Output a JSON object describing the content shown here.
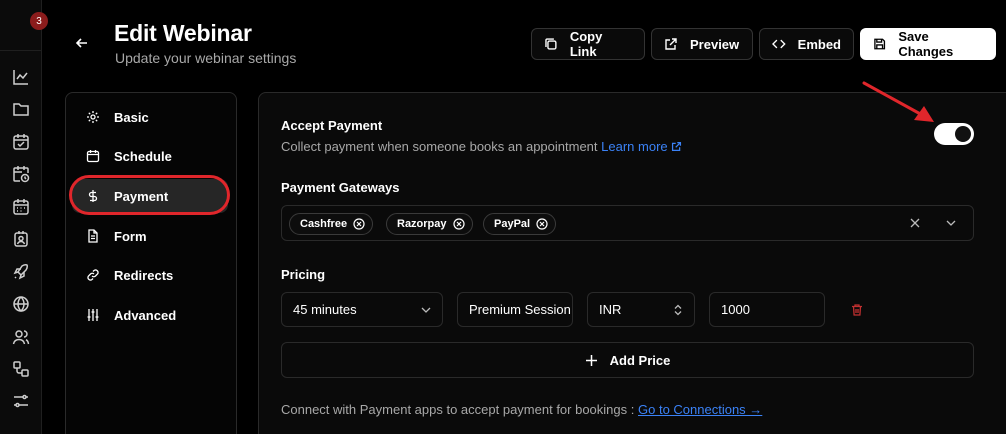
{
  "notifications": {
    "count": "3"
  },
  "header": {
    "title": "Edit Webinar",
    "subtitle": "Update your webinar settings",
    "copy_link": "Copy Link",
    "preview": "Preview",
    "embed": "Embed",
    "save": "Save Changes"
  },
  "nav": {
    "items": [
      {
        "label": "Basic",
        "icon": "gear-icon"
      },
      {
        "label": "Schedule",
        "icon": "calendar-icon"
      },
      {
        "label": "Payment",
        "icon": "dollar-icon"
      },
      {
        "label": "Form",
        "icon": "document-icon"
      },
      {
        "label": "Redirects",
        "icon": "link-icon"
      },
      {
        "label": "Advanced",
        "icon": "sliders-icon"
      }
    ],
    "active": "Payment"
  },
  "payment": {
    "accept_label": "Accept Payment",
    "accept_desc": "Collect payment when someone books an appointment",
    "learn_more": "Learn more",
    "accept_enabled": true,
    "gateways_label": "Payment Gateways",
    "gateways": [
      "Cashfree",
      "Razorpay",
      "PayPal"
    ],
    "pricing_label": "Pricing",
    "duration": "45 minutes",
    "session_name": "Premium Session",
    "currency": "INR",
    "amount": "1000",
    "add_price": "Add Price",
    "footer_text": "Connect with Payment apps to accept payment for bookings :",
    "footer_link": "Go to Connections →"
  },
  "colors": {
    "accent_red": "#e0262b",
    "link_blue": "#3b82f6",
    "badge_red": "#8b1c1c"
  }
}
